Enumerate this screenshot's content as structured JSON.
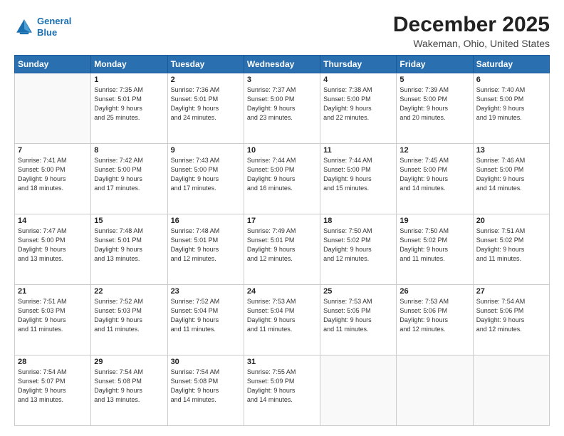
{
  "header": {
    "logo_line1": "General",
    "logo_line2": "Blue",
    "title": "December 2025",
    "subtitle": "Wakeman, Ohio, United States"
  },
  "days_of_week": [
    "Sunday",
    "Monday",
    "Tuesday",
    "Wednesday",
    "Thursday",
    "Friday",
    "Saturday"
  ],
  "weeks": [
    [
      {
        "day": "",
        "info": ""
      },
      {
        "day": "1",
        "info": "Sunrise: 7:35 AM\nSunset: 5:01 PM\nDaylight: 9 hours\nand 25 minutes."
      },
      {
        "day": "2",
        "info": "Sunrise: 7:36 AM\nSunset: 5:01 PM\nDaylight: 9 hours\nand 24 minutes."
      },
      {
        "day": "3",
        "info": "Sunrise: 7:37 AM\nSunset: 5:00 PM\nDaylight: 9 hours\nand 23 minutes."
      },
      {
        "day": "4",
        "info": "Sunrise: 7:38 AM\nSunset: 5:00 PM\nDaylight: 9 hours\nand 22 minutes."
      },
      {
        "day": "5",
        "info": "Sunrise: 7:39 AM\nSunset: 5:00 PM\nDaylight: 9 hours\nand 20 minutes."
      },
      {
        "day": "6",
        "info": "Sunrise: 7:40 AM\nSunset: 5:00 PM\nDaylight: 9 hours\nand 19 minutes."
      }
    ],
    [
      {
        "day": "7",
        "info": "Sunrise: 7:41 AM\nSunset: 5:00 PM\nDaylight: 9 hours\nand 18 minutes."
      },
      {
        "day": "8",
        "info": "Sunrise: 7:42 AM\nSunset: 5:00 PM\nDaylight: 9 hours\nand 17 minutes."
      },
      {
        "day": "9",
        "info": "Sunrise: 7:43 AM\nSunset: 5:00 PM\nDaylight: 9 hours\nand 17 minutes."
      },
      {
        "day": "10",
        "info": "Sunrise: 7:44 AM\nSunset: 5:00 PM\nDaylight: 9 hours\nand 16 minutes."
      },
      {
        "day": "11",
        "info": "Sunrise: 7:44 AM\nSunset: 5:00 PM\nDaylight: 9 hours\nand 15 minutes."
      },
      {
        "day": "12",
        "info": "Sunrise: 7:45 AM\nSunset: 5:00 PM\nDaylight: 9 hours\nand 14 minutes."
      },
      {
        "day": "13",
        "info": "Sunrise: 7:46 AM\nSunset: 5:00 PM\nDaylight: 9 hours\nand 14 minutes."
      }
    ],
    [
      {
        "day": "14",
        "info": "Sunrise: 7:47 AM\nSunset: 5:00 PM\nDaylight: 9 hours\nand 13 minutes."
      },
      {
        "day": "15",
        "info": "Sunrise: 7:48 AM\nSunset: 5:01 PM\nDaylight: 9 hours\nand 13 minutes."
      },
      {
        "day": "16",
        "info": "Sunrise: 7:48 AM\nSunset: 5:01 PM\nDaylight: 9 hours\nand 12 minutes."
      },
      {
        "day": "17",
        "info": "Sunrise: 7:49 AM\nSunset: 5:01 PM\nDaylight: 9 hours\nand 12 minutes."
      },
      {
        "day": "18",
        "info": "Sunrise: 7:50 AM\nSunset: 5:02 PM\nDaylight: 9 hours\nand 12 minutes."
      },
      {
        "day": "19",
        "info": "Sunrise: 7:50 AM\nSunset: 5:02 PM\nDaylight: 9 hours\nand 11 minutes."
      },
      {
        "day": "20",
        "info": "Sunrise: 7:51 AM\nSunset: 5:02 PM\nDaylight: 9 hours\nand 11 minutes."
      }
    ],
    [
      {
        "day": "21",
        "info": "Sunrise: 7:51 AM\nSunset: 5:03 PM\nDaylight: 9 hours\nand 11 minutes."
      },
      {
        "day": "22",
        "info": "Sunrise: 7:52 AM\nSunset: 5:03 PM\nDaylight: 9 hours\nand 11 minutes."
      },
      {
        "day": "23",
        "info": "Sunrise: 7:52 AM\nSunset: 5:04 PM\nDaylight: 9 hours\nand 11 minutes."
      },
      {
        "day": "24",
        "info": "Sunrise: 7:53 AM\nSunset: 5:04 PM\nDaylight: 9 hours\nand 11 minutes."
      },
      {
        "day": "25",
        "info": "Sunrise: 7:53 AM\nSunset: 5:05 PM\nDaylight: 9 hours\nand 11 minutes."
      },
      {
        "day": "26",
        "info": "Sunrise: 7:53 AM\nSunset: 5:06 PM\nDaylight: 9 hours\nand 12 minutes."
      },
      {
        "day": "27",
        "info": "Sunrise: 7:54 AM\nSunset: 5:06 PM\nDaylight: 9 hours\nand 12 minutes."
      }
    ],
    [
      {
        "day": "28",
        "info": "Sunrise: 7:54 AM\nSunset: 5:07 PM\nDaylight: 9 hours\nand 13 minutes."
      },
      {
        "day": "29",
        "info": "Sunrise: 7:54 AM\nSunset: 5:08 PM\nDaylight: 9 hours\nand 13 minutes."
      },
      {
        "day": "30",
        "info": "Sunrise: 7:54 AM\nSunset: 5:08 PM\nDaylight: 9 hours\nand 14 minutes."
      },
      {
        "day": "31",
        "info": "Sunrise: 7:55 AM\nSunset: 5:09 PM\nDaylight: 9 hours\nand 14 minutes."
      },
      {
        "day": "",
        "info": ""
      },
      {
        "day": "",
        "info": ""
      },
      {
        "day": "",
        "info": ""
      }
    ]
  ]
}
